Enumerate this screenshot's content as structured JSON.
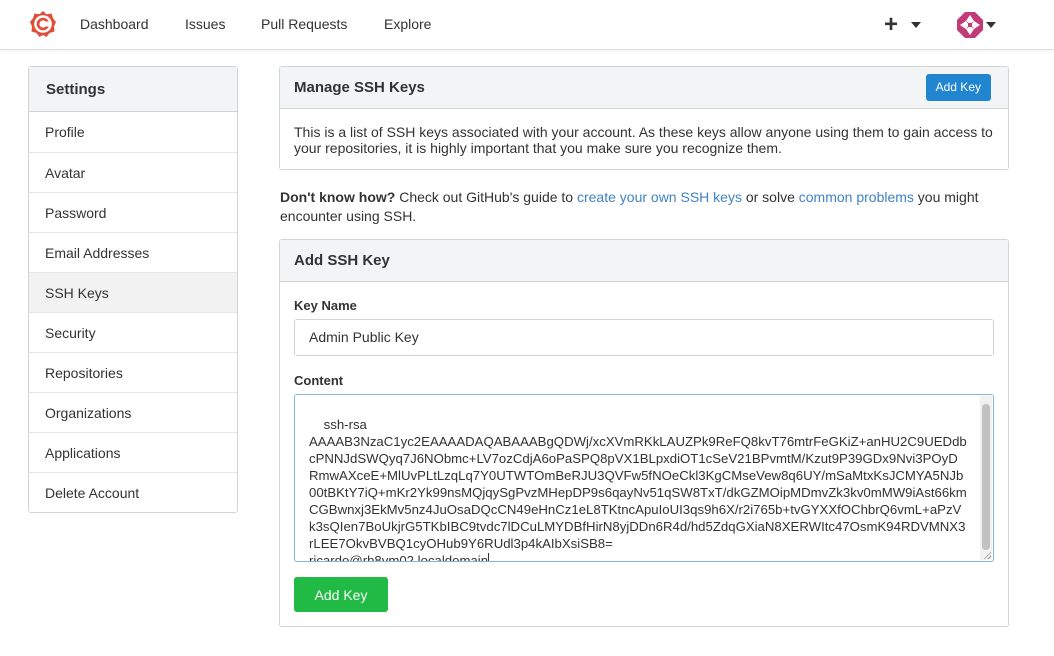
{
  "nav": {
    "items": [
      "Dashboard",
      "Issues",
      "Pull Requests",
      "Explore"
    ],
    "plus_icon": "+"
  },
  "sidebar": {
    "title": "Settings",
    "items": [
      {
        "label": "Profile"
      },
      {
        "label": "Avatar"
      },
      {
        "label": "Password"
      },
      {
        "label": "Email Addresses"
      },
      {
        "label": "SSH Keys"
      },
      {
        "label": "Security"
      },
      {
        "label": "Repositories"
      },
      {
        "label": "Organizations"
      },
      {
        "label": "Applications"
      },
      {
        "label": "Delete Account"
      }
    ],
    "active": "SSH Keys"
  },
  "manage": {
    "title": "Manage SSH Keys",
    "add_button": "Add Key",
    "description": "This is a list of SSH keys associated with your account. As these keys allow anyone using them to gain access to your repositories, it is highly important that you make sure you recognize them."
  },
  "help": {
    "bold": "Don't know how?",
    "text1": " Check out GitHub's guide to ",
    "link1": "create your own SSH keys",
    "text2": " or solve ",
    "link2": "common problems",
    "text3": " you might encounter using SSH."
  },
  "add": {
    "title": "Add SSH Key",
    "key_name_label": "Key Name",
    "key_name_value": "Admin Public Key",
    "content_label": "Content",
    "content_value": "ssh-rsa\nAAAAB3NzaC1yc2EAAAADAQABAAABgQDWj/xcXVmRKkLAUZPk9ReFQ8kvT76mtrFeGKiZ+anHU2C9UEDdbcPNNJdSWQyq7J6NObmc+LV7ozCdjA6oPaSPQ8pVX1BLpxdiOT1cSeV21BPvmtM/Kzut9P39GDx9Nvi3POyDRmwAXceE+MlUvPLtLzqLq7Y0UTWTOmBeRJU3QVFw5fNOeCkl3KgCMseVew8q6UY/mSaMtxKsJCMYA5NJb00tBKtY7iQ+mKr2Yk99nsMQjqySgPvzMHepDP9s6qayNv51qSW8TxT/dkGZMOipMDmvZk3kv0mMW9iAst66kmCGBwnxj3EkMv5nz4JuOsaDQcCN49eHnCz1eL8TKtncApuIoUI3qs9h6X/r2i765b+tvGYXXfOChbrQ6vmL+aPzVk3sQIen7BoUkjrG5TKbIBC9tvdc7lDCuLMYDBfHirN8yjDDn6R4d/hd5ZdqGXiaN8XERWItc47OsmK94RDVMNX3rLEE7OkvBVBQ1cyOHub9Y6RUdl3p4kAIbXsiSB8=\nricardo@rh8vm02.localdomain",
    "submit_button": "Add Key"
  }
}
